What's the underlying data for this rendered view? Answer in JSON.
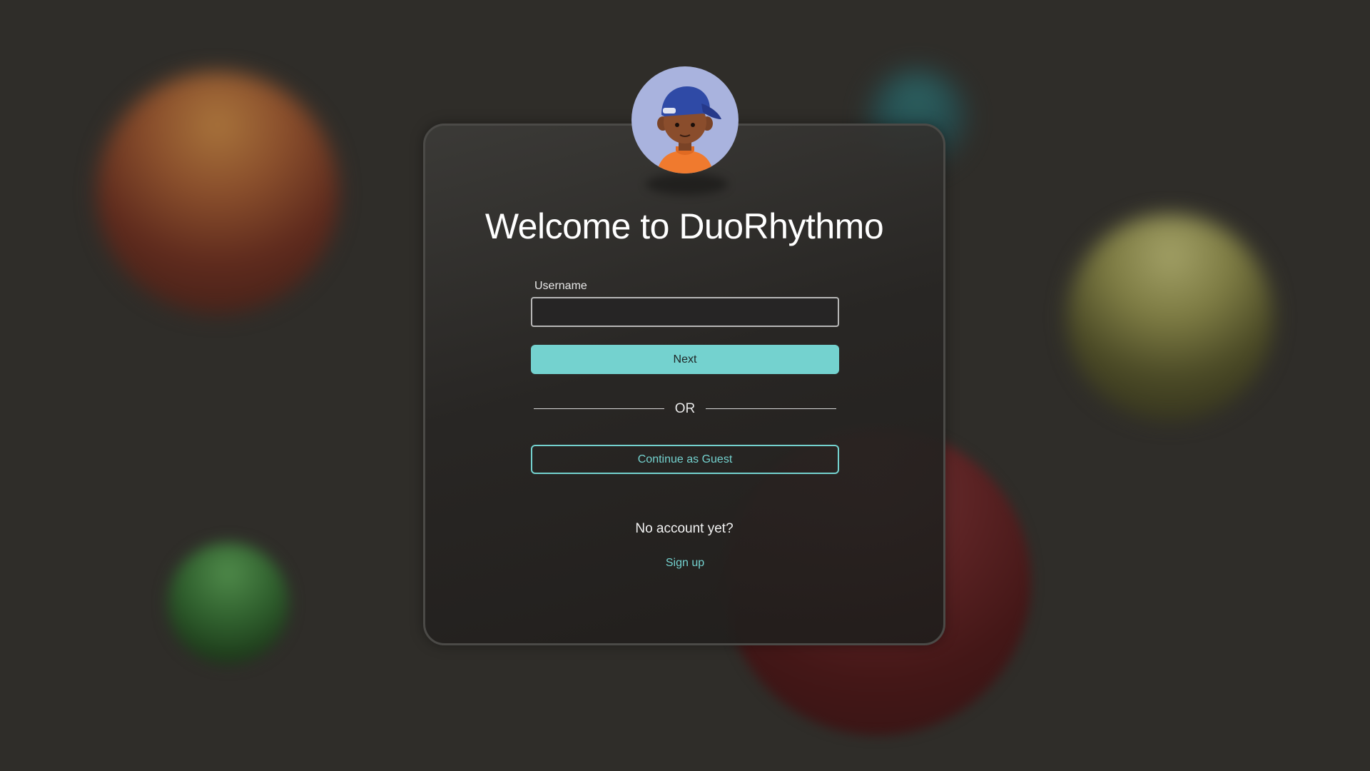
{
  "app": {
    "title": "Welcome to DuoRhythmo"
  },
  "avatar": {
    "icon": "user-avatar-cap-icon"
  },
  "login_form": {
    "username_label": "Username",
    "username_value": "",
    "username_placeholder": "",
    "next_label": "Next",
    "divider_text": "OR",
    "guest_label": "Continue as Guest",
    "no_account_text": "No account yet?",
    "signup_label": "Sign up"
  },
  "colors": {
    "accent": "#74d2cf",
    "background": "#2f2d29",
    "card_border": "#4b4a47"
  }
}
